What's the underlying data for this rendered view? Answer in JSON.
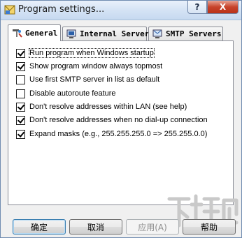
{
  "window": {
    "title": "Program settings...",
    "help_symbol": "?",
    "close_symbol": "X"
  },
  "tabs": [
    {
      "label": "General",
      "icon": "tools-icon",
      "selected": true
    },
    {
      "label": "Internal Server",
      "icon": "server-icon",
      "selected": false
    },
    {
      "label": "SMTP Servers",
      "icon": "mail-server-icon",
      "selected": false
    }
  ],
  "options": [
    {
      "label": "Run program when Windows startup",
      "checked": true
    },
    {
      "label": "Show program window always topmost",
      "checked": true
    },
    {
      "label": "Use first SMTP server in list as default",
      "checked": false
    },
    {
      "label": "Disable autoroute feature",
      "checked": false
    },
    {
      "label": "Don't resolve addresses within LAN (see help)",
      "checked": true
    },
    {
      "label": "Don't resolve addresses when no dial-up connection",
      "checked": true
    },
    {
      "label": "Expand masks (e.g., 255.255.255.0 => 255.255.0.0)",
      "checked": true
    }
  ],
  "buttons": {
    "ok": "确定",
    "cancel": "取消",
    "apply": "应用(A)",
    "help": "帮助"
  },
  "watermark": "下载吧"
}
